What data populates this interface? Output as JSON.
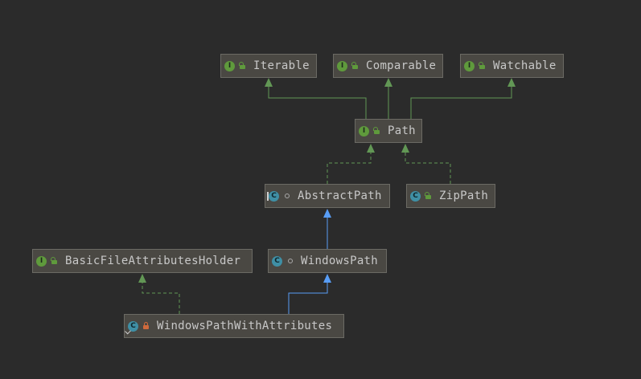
{
  "diagram": {
    "nodes": {
      "iterable": {
        "label": "Iterable",
        "kind": "interface",
        "icon_letter": "I",
        "visibility": "public"
      },
      "comparable": {
        "label": "Comparable",
        "kind": "interface",
        "icon_letter": "I",
        "visibility": "public"
      },
      "watchable": {
        "label": "Watchable",
        "kind": "interface",
        "icon_letter": "I",
        "visibility": "public"
      },
      "path": {
        "label": "Path",
        "kind": "interface",
        "icon_letter": "I",
        "visibility": "public"
      },
      "abstract_path": {
        "label": "AbstractPath",
        "kind": "abstract-class",
        "icon_letter": "C",
        "visibility": "package"
      },
      "zip_path": {
        "label": "ZipPath",
        "kind": "class",
        "icon_letter": "C",
        "visibility": "public"
      },
      "basic_holder": {
        "label": "BasicFileAttributesHolder",
        "kind": "interface",
        "icon_letter": "I",
        "visibility": "public"
      },
      "windows_path": {
        "label": "WindowsPath",
        "kind": "class",
        "icon_letter": "C",
        "visibility": "package"
      },
      "windows_path_with_attributes": {
        "label": "WindowsPathWithAttributes",
        "kind": "final-class",
        "icon_letter": "C",
        "visibility": "private"
      }
    },
    "edges": [
      {
        "from": "path",
        "to": "iterable",
        "relation": "extends"
      },
      {
        "from": "path",
        "to": "comparable",
        "relation": "extends"
      },
      {
        "from": "path",
        "to": "watchable",
        "relation": "extends"
      },
      {
        "from": "abstract_path",
        "to": "path",
        "relation": "implements"
      },
      {
        "from": "zip_path",
        "to": "path",
        "relation": "implements"
      },
      {
        "from": "windows_path",
        "to": "abstract_path",
        "relation": "extends"
      },
      {
        "from": "windows_path_with_attributes",
        "to": "windows_path",
        "relation": "extends"
      },
      {
        "from": "windows_path_with_attributes",
        "to": "basic_holder",
        "relation": "implements"
      }
    ],
    "colors": {
      "background": "#2b2b2b",
      "node_fill": "#4a4843",
      "interface_edge": "#629755",
      "class_edge": "#589df6",
      "interface_icon": "#5f9a3c",
      "class_icon": "#3f8fa5"
    }
  }
}
